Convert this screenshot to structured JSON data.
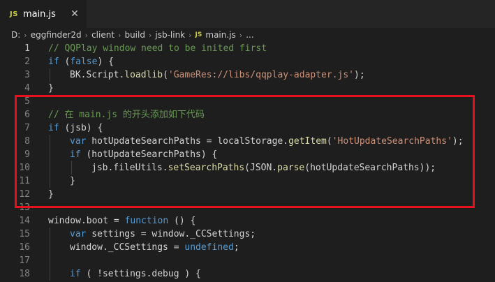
{
  "tab": {
    "badge": "JS",
    "filename": "main.js",
    "close_glyph": "✕"
  },
  "breadcrumb": {
    "items": [
      "D:",
      "eggfinder2d",
      "client",
      "build",
      "jsb-link"
    ],
    "file_badge": "JS",
    "file": "main.js",
    "trailing": "..."
  },
  "lines": [
    {
      "n": "1",
      "indent": 0,
      "tokens": [
        [
          "com",
          "// QQPlay window need to be inited first"
        ]
      ]
    },
    {
      "n": "2",
      "indent": 0,
      "tokens": [
        [
          "kw",
          "if"
        ],
        [
          "pl",
          " ("
        ],
        [
          "kw",
          "false"
        ],
        [
          "pl",
          ") {"
        ]
      ]
    },
    {
      "n": "3",
      "indent": 1,
      "tokens": [
        [
          "pl",
          "BK.Script."
        ],
        [
          "fn",
          "loadlib"
        ],
        [
          "pl",
          "("
        ],
        [
          "str",
          "'GameRes://libs/qqplay-adapter.js'"
        ],
        [
          "pl",
          ");"
        ]
      ]
    },
    {
      "n": "4",
      "indent": 0,
      "tokens": [
        [
          "pl",
          "}"
        ]
      ]
    },
    {
      "n": "5",
      "indent": 0,
      "tokens": []
    },
    {
      "n": "6",
      "indent": 0,
      "tokens": [
        [
          "com",
          "// 在 main.js 的开头添加如下代码"
        ]
      ]
    },
    {
      "n": "7",
      "indent": 0,
      "tokens": [
        [
          "kw",
          "if"
        ],
        [
          "pl",
          " (jsb) {"
        ]
      ]
    },
    {
      "n": "8",
      "indent": 1,
      "tokens": [
        [
          "kw",
          "var"
        ],
        [
          "pl",
          " hotUpdateSearchPaths = localStorage."
        ],
        [
          "fn",
          "getItem"
        ],
        [
          "pl",
          "("
        ],
        [
          "str",
          "'HotUpdateSearchPaths'"
        ],
        [
          "pl",
          ");"
        ]
      ]
    },
    {
      "n": "9",
      "indent": 1,
      "tokens": [
        [
          "kw",
          "if"
        ],
        [
          "pl",
          " (hotUpdateSearchPaths) {"
        ]
      ]
    },
    {
      "n": "10",
      "indent": 2,
      "tokens": [
        [
          "pl",
          "jsb.fileUtils."
        ],
        [
          "fn",
          "setSearchPaths"
        ],
        [
          "pl",
          "(JSON."
        ],
        [
          "fn",
          "parse"
        ],
        [
          "pl",
          "(hotUpdateSearchPaths));"
        ]
      ]
    },
    {
      "n": "11",
      "indent": 1,
      "tokens": [
        [
          "pl",
          "}"
        ]
      ]
    },
    {
      "n": "12",
      "indent": 0,
      "tokens": [
        [
          "pl",
          "}"
        ]
      ]
    },
    {
      "n": "13",
      "indent": 0,
      "tokens": []
    },
    {
      "n": "14",
      "indent": 0,
      "tokens": [
        [
          "pl",
          "window.boot = "
        ],
        [
          "kw",
          "function"
        ],
        [
          "pl",
          " () {"
        ]
      ]
    },
    {
      "n": "15",
      "indent": 1,
      "tokens": [
        [
          "kw",
          "var"
        ],
        [
          "pl",
          " settings = window._CCSettings;"
        ]
      ]
    },
    {
      "n": "16",
      "indent": 1,
      "tokens": [
        [
          "pl",
          "window._CCSettings = "
        ],
        [
          "kw",
          "undefined"
        ],
        [
          "pl",
          ";"
        ]
      ]
    },
    {
      "n": "17",
      "indent": 0,
      "tokens": []
    },
    {
      "n": "18",
      "indent": 1,
      "tokens": [
        [
          "kw",
          "if"
        ],
        [
          "pl",
          " ( !settings.debug ) {"
        ]
      ]
    }
  ],
  "colors": {
    "background": "#1e1e1e",
    "comment": "#6a9955",
    "keyword": "#569cd6",
    "string": "#ce9178",
    "function": "#dcdcaa",
    "highlight_box": "#e8101c"
  }
}
